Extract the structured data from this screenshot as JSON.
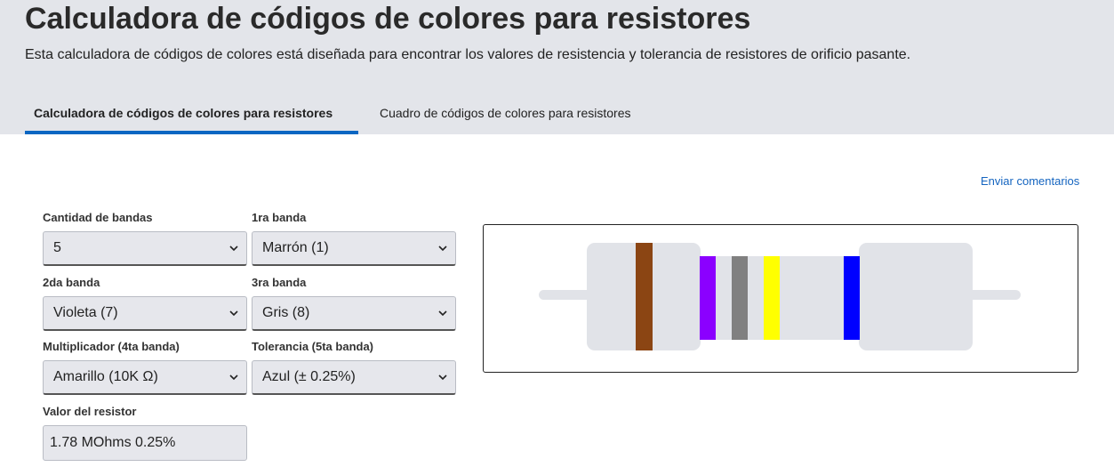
{
  "header": {
    "title": "Calculadora de códigos de colores para resistores",
    "description": "Esta calculadora de códigos de colores está diseñada para encontrar los valores de resistencia y tolerancia de resistores de orificio pasante."
  },
  "tabs": [
    {
      "label": "Calculadora de códigos de colores para resistores",
      "active": true
    },
    {
      "label": "Cuadro de códigos de colores para resistores",
      "active": false
    }
  ],
  "feedback_link": "Enviar comentarios",
  "form": {
    "band_count": {
      "label": "Cantidad de bandas",
      "value": "5"
    },
    "band1": {
      "label": "1ra banda",
      "value": "Marrón (1)"
    },
    "band2": {
      "label": "2da banda",
      "value": "Violeta (7)"
    },
    "band3": {
      "label": "3ra banda",
      "value": "Gris (8)"
    },
    "multiplier": {
      "label": "Multiplicador (4ta banda)",
      "value": "Amarillo (10K Ω)"
    },
    "tolerance": {
      "label": "Tolerancia (5ta banda)",
      "value": "Azul (± 0.25%)"
    },
    "result": {
      "label": "Valor del resistor",
      "value": "1.78 MOhms 0.25%"
    }
  },
  "resistor": {
    "body_color": "#e1e3e8",
    "lead_color": "#e1e3e8",
    "bands": [
      {
        "name": "band-1",
        "color": "#8b4513"
      },
      {
        "name": "band-2",
        "color": "#8b00ff"
      },
      {
        "name": "band-3",
        "color": "#808080"
      },
      {
        "name": "band-multiplier",
        "color": "#ffff00"
      },
      {
        "name": "band-tolerance",
        "color": "#0000ff"
      }
    ]
  },
  "colors": {
    "hero_bg": "#e3e5ea",
    "accent": "#0a66c2",
    "link": "#1565c0"
  }
}
